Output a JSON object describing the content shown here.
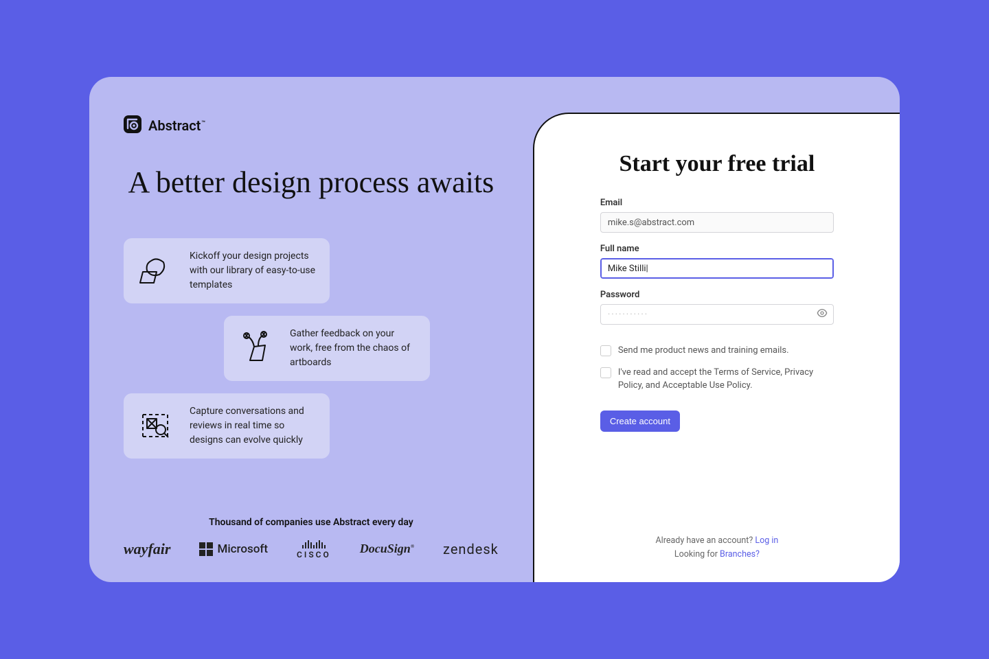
{
  "brand": {
    "name": "Abstract"
  },
  "headline": "A better design process awaits",
  "features": [
    {
      "text": "Kickoff your design projects with our library of easy-to-use templates"
    },
    {
      "text": "Gather feedback on your work, free from the chaos of artboards"
    },
    {
      "text": "Capture conversations and reviews in real time so designs can evolve quickly"
    }
  ],
  "companies_caption": "Thousand of companies use Abstract every day",
  "companies": {
    "wayfair": "wayfair",
    "microsoft": "Microsoft",
    "cisco": "CISCO",
    "docusign": "DocuSign",
    "zendesk": "zendesk"
  },
  "form": {
    "title": "Start your free trial",
    "email_label": "Email",
    "email_value": "mike.s@abstract.com",
    "fullname_label": "Full name",
    "fullname_value": "Mike Stilli",
    "password_label": "Password",
    "password_mask": "···········",
    "newsletter_label": "Send me product news and training emails.",
    "terms_label": "I've read and accept the Terms of Service, Privacy Policy, and Acceptable Use Policy.",
    "submit": "Create account"
  },
  "footer": {
    "have_account_prefix": "Already have an account? ",
    "login": "Log in",
    "looking_prefix": "Looking for ",
    "branches": "Branches?"
  }
}
